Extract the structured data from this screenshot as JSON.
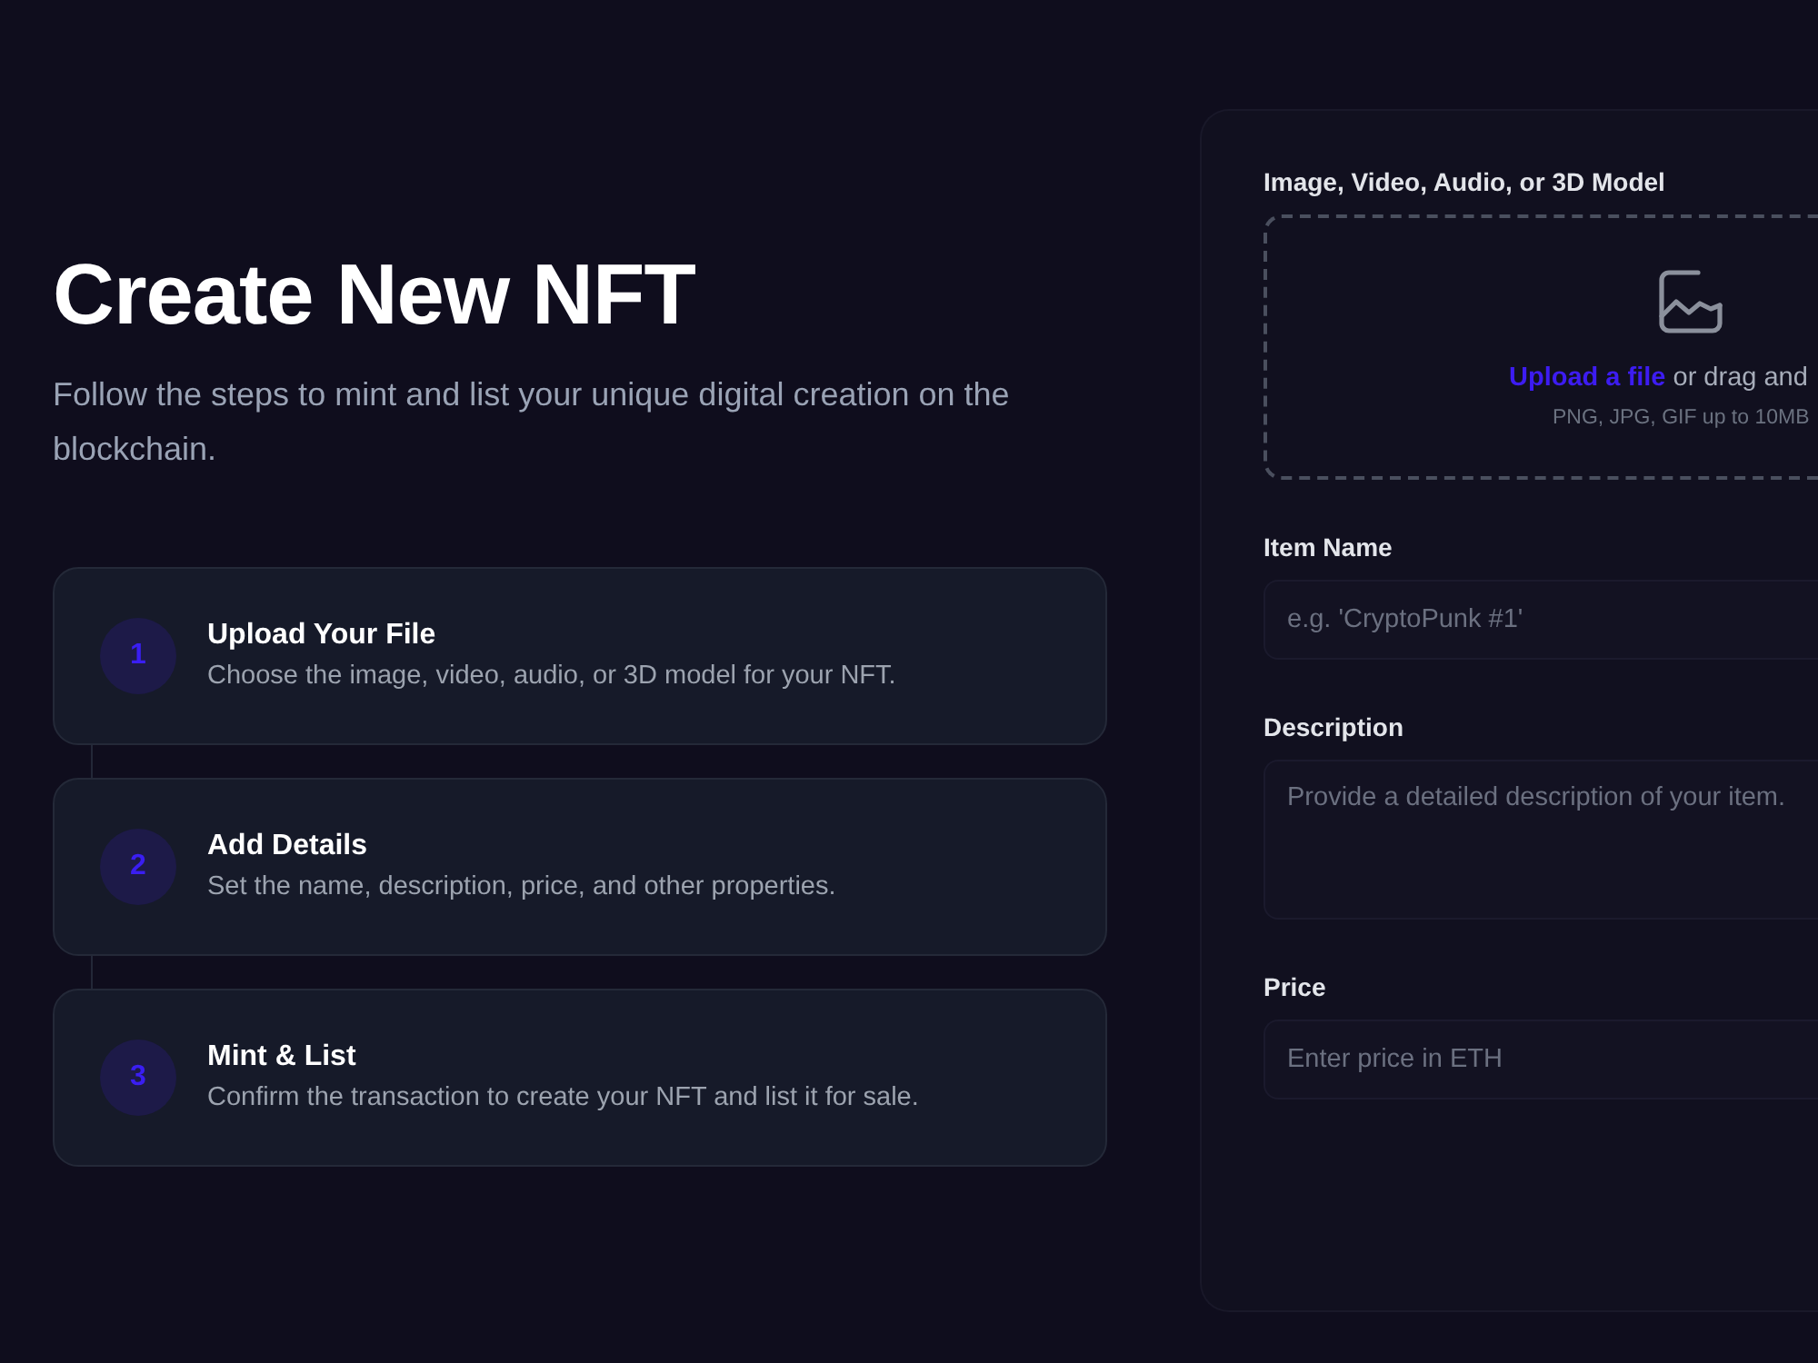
{
  "header": {
    "title": "Create New NFT",
    "subtitle": "Follow the steps to mint and list your unique digital creation on the blockchain."
  },
  "steps": [
    {
      "number": "1",
      "title": "Upload Your File",
      "description": "Choose the image, video, audio, or 3D model for your NFT."
    },
    {
      "number": "2",
      "title": "Add Details",
      "description": "Set the name, description, price, and other properties."
    },
    {
      "number": "3",
      "title": "Mint & List",
      "description": "Confirm the transaction to create your NFT and list it for sale."
    }
  ],
  "form": {
    "upload": {
      "label": "Image, Video, Audio, or 3D Model",
      "link": "Upload a file",
      "text": "or drag and",
      "hint": "PNG, JPG, GIF up to 10MB"
    },
    "fields": [
      {
        "kind": "input",
        "label": "Item Name",
        "placeholder": "e.g. 'CryptoPunk #1'"
      },
      {
        "kind": "textarea",
        "label": "Description",
        "placeholder": "Provide a detailed description of your item."
      },
      {
        "kind": "input",
        "label": "Price",
        "placeholder": "Enter price in ETH"
      }
    ]
  }
}
